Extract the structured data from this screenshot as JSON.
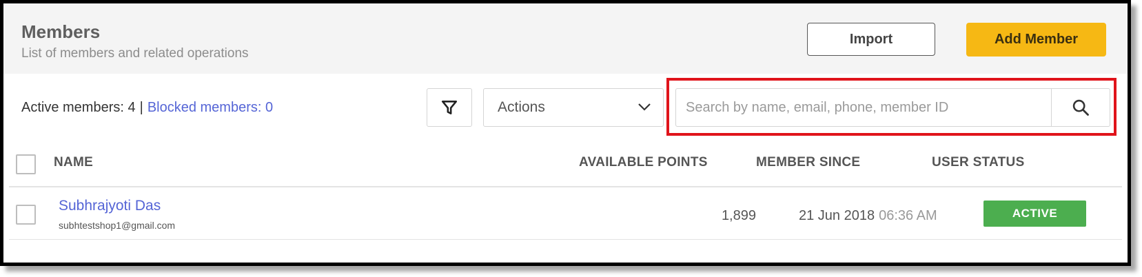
{
  "header": {
    "title": "Members",
    "subtitle": "List of members and related operations",
    "import_label": "Import",
    "add_member_label": "Add Member"
  },
  "toolbar": {
    "active_members": "Active members: 4",
    "separator": "|",
    "blocked_members": "Blocked members: 0",
    "filter_icon": "filter-icon",
    "actions_label": "Actions",
    "search_placeholder": "Search by name, email, phone, member ID",
    "search_value": "",
    "search_icon": "search-icon",
    "highlight_color": "#e0141b"
  },
  "table": {
    "columns": [
      "NAME",
      "AVAILABLE POINTS",
      "MEMBER SINCE",
      "USER STATUS"
    ],
    "rows": [
      {
        "name": "Subhrajyoti Das",
        "email": "subhtestshop1@gmail.com",
        "points": "1,899",
        "since_date": "21 Jun 2018",
        "since_time": "06:36 AM",
        "status": "ACTIVE",
        "status_color": "#4cae4f"
      }
    ]
  },
  "colors": {
    "accent_yellow": "#f6b814",
    "link_blue": "#5565d6",
    "active_green": "#4cae4f"
  }
}
